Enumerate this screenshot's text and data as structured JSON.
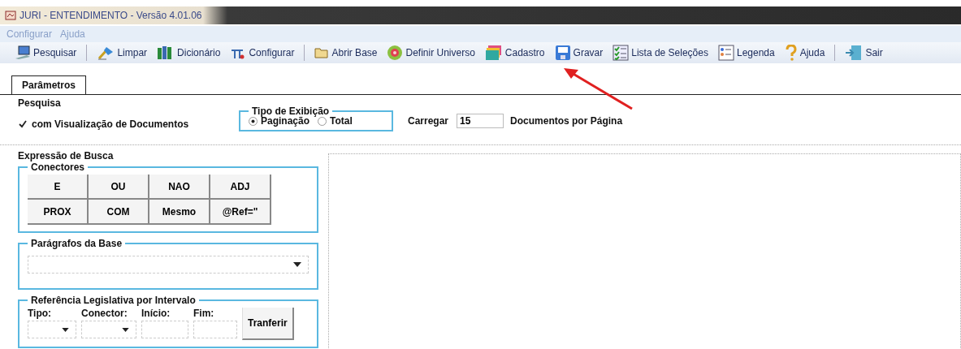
{
  "window": {
    "title": "JURI - ENTENDIMENTO - Versão 4.01.06"
  },
  "menu": [
    "Configurar",
    "Ajuda"
  ],
  "toolbar": [
    {
      "label": "Pesquisar",
      "separator_after": true
    },
    {
      "label": "Limpar",
      "separator_after": false
    },
    {
      "label": "Dicionário",
      "separator_after": false
    },
    {
      "label": "Configurar",
      "separator_after": true
    },
    {
      "label": "Abrir Base",
      "separator_after": false
    },
    {
      "label": "Definir Universo",
      "separator_after": false
    },
    {
      "label": "Cadastro",
      "separator_after": false
    },
    {
      "label": "Gravar",
      "separator_after": false
    },
    {
      "label": "Lista de Seleções",
      "separator_after": false
    },
    {
      "label": "Legenda",
      "separator_after": false
    },
    {
      "label": "Ajuda",
      "separator_after": true
    },
    {
      "label": "Sair",
      "separator_after": false
    }
  ],
  "tabs": [
    {
      "label": "Parâmetros",
      "selected": true
    }
  ],
  "pesquisa": {
    "title": "Pesquisa",
    "checkbox": {
      "label": "com Visualização de Documentos",
      "checked": true
    },
    "tipo_exibicao": {
      "title": "Tipo de Exibição",
      "options": [
        {
          "label": "Paginação",
          "selected": true
        },
        {
          "label": "Total",
          "selected": false
        }
      ]
    },
    "carregar": {
      "label": "Carregar",
      "value": "15",
      "suffix": "Documentos por Página"
    }
  },
  "expressao": {
    "title": "Expressão de Busca",
    "conectores": {
      "title": "Conectores",
      "buttons": [
        "E",
        "OU",
        "NAO",
        "ADJ",
        "PROX",
        "COM",
        "Mesmo",
        "@Ref=\""
      ]
    },
    "paragrafos": {
      "title": "Parágrafos da Base"
    },
    "referencia": {
      "title": "Referência Legislativa por Intervalo",
      "labels": [
        "Tipo:",
        "Conector:",
        "Início:",
        "Fim:"
      ],
      "button": "Tranferir"
    }
  }
}
